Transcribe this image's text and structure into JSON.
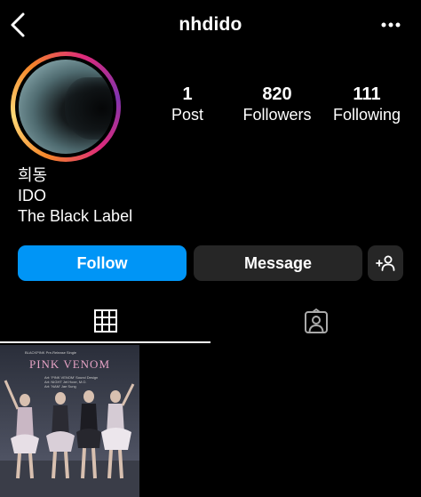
{
  "header": {
    "username": "nhdido"
  },
  "profile": {
    "stats": [
      {
        "value": "1",
        "label": "Post"
      },
      {
        "value": "820",
        "label": "Followers"
      },
      {
        "value": "111",
        "label": "Following"
      }
    ],
    "bio_lines": [
      "희동",
      "IDO",
      "The Black Label"
    ]
  },
  "actions": {
    "follow_label": "Follow",
    "message_label": "Message"
  },
  "tabs": [
    {
      "icon": "grid-icon",
      "active": true
    },
    {
      "icon": "tagged-icon",
      "active": false
    }
  ],
  "posts": [
    {
      "title": "PINK VENOM",
      "subtitle": "BLACKPINK Pre-Release Single",
      "lines": [
        "Art: 'PINK VENOM' Sound Design",
        "Art: NIGHT Jet Hoxe, M.O.",
        "Art: 'NAM' Jae Sung"
      ]
    }
  ],
  "colors": {
    "background": "#000000",
    "follow_button": "#0095f6",
    "secondary_button": "#262626",
    "post_title": "#e6a3c5"
  }
}
